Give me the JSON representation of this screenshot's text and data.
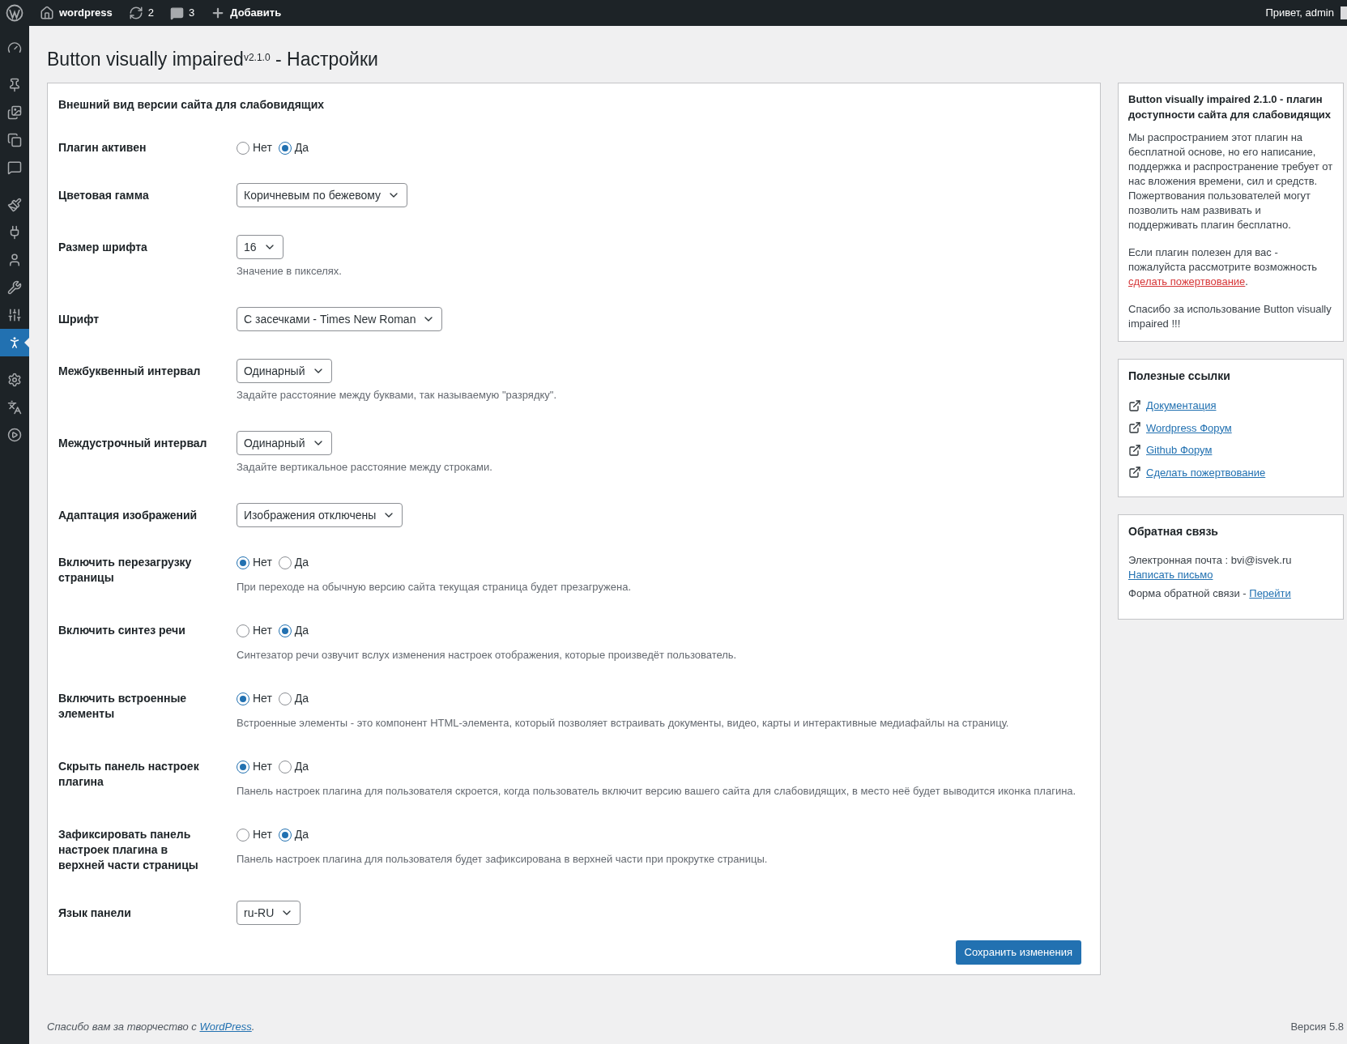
{
  "admin_bar": {
    "site": "wordpress",
    "updates": "2",
    "comments": "3",
    "new": "Добавить",
    "greeting": "Привет, admin"
  },
  "sidebar": {
    "items": [
      {
        "kind": "dashboard",
        "selected": false
      },
      {
        "kind": "posts",
        "selected": false
      },
      {
        "kind": "media",
        "selected": false
      },
      {
        "kind": "pages",
        "selected": false
      },
      {
        "kind": "comments",
        "selected": false
      },
      {
        "kind": "appearance",
        "selected": false
      },
      {
        "kind": "plugins",
        "selected": false
      },
      {
        "kind": "users",
        "selected": false
      },
      {
        "kind": "tools",
        "selected": false
      },
      {
        "kind": "custom",
        "selected": false
      },
      {
        "kind": "accessibility",
        "selected": true
      },
      {
        "kind": "settings",
        "selected": false
      },
      {
        "kind": "translate",
        "selected": false
      },
      {
        "kind": "media_player",
        "selected": false
      }
    ]
  },
  "page": {
    "title": "Button visually impaired$^{v2.1.0}$ - Настройки"
  },
  "settings": {
    "heading": "Внешний вид версии сайта для слабовидящих",
    "rows": [
      {
        "label": "Плагин активен",
        "kind": "radio",
        "options": [
          {
            "label": "Нет",
            "selected": false
          },
          {
            "label": "Да",
            "selected": true
          }
        ]
      },
      {
        "label": "Цветовая гамма",
        "kind": "select",
        "value": "Коричневым по бежевому"
      },
      {
        "label": "Размер шрифта",
        "kind": "select",
        "value": "16",
        "help": "Значение в пикселях."
      },
      {
        "label": "Шрифт",
        "kind": "select",
        "value": "С засечками - Times New Roman"
      },
      {
        "label": "Межбуквенный интервал",
        "kind": "select",
        "value": "Одинарный",
        "help": "Задайте расстояние между буквами, так называемую \"разрядку\"."
      },
      {
        "label": "Междустрочный интервал",
        "kind": "select",
        "value": "Одинарный",
        "help": "Задайте вертикальное расстояние между строками."
      },
      {
        "label": "Адаптация изображений",
        "kind": "select",
        "value": "Изображения отключены"
      },
      {
        "label": "Включить перезагрузку страницы",
        "kind": "radio",
        "options": [
          {
            "label": "Нет",
            "selected": true
          },
          {
            "label": "Да",
            "selected": false
          }
        ],
        "help": "При переходе на обычную версию сайта текущая страница будет презагружена."
      },
      {
        "label": "Включить синтез речи",
        "kind": "radio",
        "options": [
          {
            "label": "Нет",
            "selected": false
          },
          {
            "label": "Да",
            "selected": true
          }
        ],
        "help": "Синтезатор речи озвучит вслух изменения настроек отображения, которые произведёт пользователь."
      },
      {
        "label": "Включить встроенные элементы",
        "kind": "radio",
        "options": [
          {
            "label": "Нет",
            "selected": true
          },
          {
            "label": "Да",
            "selected": false
          }
        ],
        "help": "Встроенные элементы - это компонент HTML-элемента, который позволяет встраивать документы, видео, карты и интерактивные медиафайлы на страницу."
      },
      {
        "label": "Скрыть панель настроек плагина",
        "kind": "radio",
        "options": [
          {
            "label": "Нет",
            "selected": true
          },
          {
            "label": "Да",
            "selected": false
          }
        ],
        "help": "Панель настроек плагина для пользователя скроется, когда пользователь включит версию вашего сайта для слабовидящих, в место неё будет выводится иконка плагина."
      },
      {
        "label": "Зафиксировать панель настроек плагина в верхней части страницы",
        "kind": "radio",
        "options": [
          {
            "label": "Нет",
            "selected": false
          },
          {
            "label": "Да",
            "selected": true
          }
        ],
        "help": "Панель настроек плагина для пользователя будет зафиксирована в верхней части при прокрутке страницы."
      },
      {
        "label": "Язык панели",
        "kind": "select",
        "value": "ru-RU"
      }
    ],
    "save_button": "Сохранить изменения"
  },
  "about_box": {
    "title": "Button visually impaired 2.1.0 - плагин доступности сайта для слабовидящих",
    "intro": "Мы распространием этот плагин на бесплатной основе, но его написание, поддержка и распространение требует от нас вложения времени, сил и средств. Пожертвования пользователей могут позволить нам развивать и поддерживать плагин бесплатно.",
    "donate_text": "Если плагин полезен для вас - пожалуйста рассмотрите возможность ",
    "donate_link": "сделать пожертвование",
    "donate_end": ".",
    "thanks": "Спасибо за использование Button visually impaired !!!"
  },
  "links_box": {
    "title": "Полезные ссылки",
    "links": [
      "Документация",
      "Wordpress Форум",
      "Github Форум",
      "Сделать пожертвование"
    ]
  },
  "feedback_box": {
    "title": "Обратная связь",
    "email": "Электронная почта : bvi@isvek.ru",
    "email_link": "Написать письмо",
    "form_text": "Форма обратной связи - ",
    "form_link": "Перейти"
  },
  "footer": {
    "thanks": "Спасибо вам за творчество с ",
    "link": "WordPress",
    "end": ".",
    "version": "Версия 5.8"
  }
}
